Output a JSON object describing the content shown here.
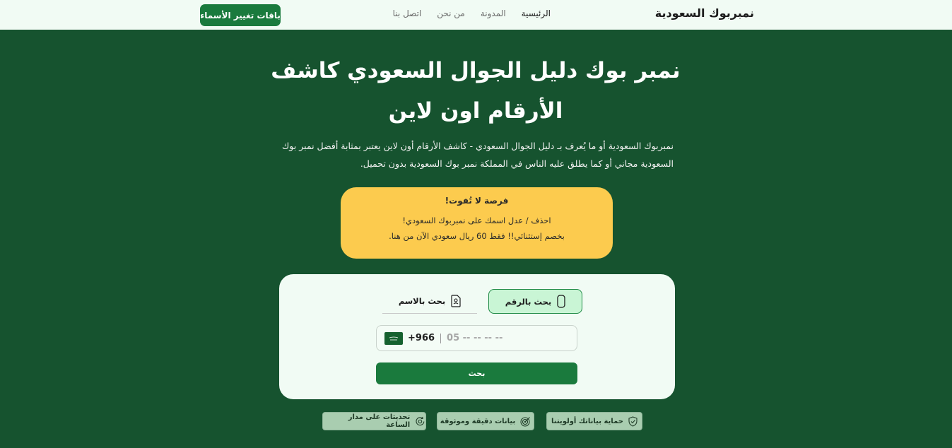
{
  "header": {
    "brand": "نمبربوك السعودية",
    "nav": [
      "الرئيسية",
      "المدونة",
      "من نحن",
      "اتصل بنا"
    ],
    "cta": "باقات تغيير الأسماء"
  },
  "hero": {
    "title_line1": "نمبر بوك دليل الجوال السعودي كاشف",
    "title_line2": "الأرقام اون لاين",
    "desc_line1": "نمبربوك السعودية أو ما يُعرف بـ دليل الجوال السعودي - كاشف الأرقام أون لاين يعتبر بمثابة أفضل نمبر بوك",
    "desc_line2": "السعودية مجاني أو كما يطلق عليه الناس في المملكة نمبر بوك السعودية بدون تحميل."
  },
  "promo": {
    "title": "فرصة لا تُفوت!",
    "line1": "احذف / عدل اسمك على نمبربوك السعودي!",
    "line2": "بخصم إستثنائي!! فقط 60 ريال سعودي الآن من هنا."
  },
  "search": {
    "tab_number": "بحث بالرقم",
    "tab_name": "بحث بالاسم",
    "country_code": "+966",
    "placeholder": "05 -- -- -- --",
    "button": "بحث"
  },
  "features": [
    {
      "label": "حماية بياناتك أولويتنا",
      "icon": "shield-icon"
    },
    {
      "label": "بيانات دقيقة وموثوقة",
      "icon": "target-icon"
    },
    {
      "label": "تحديثات على مدار الساعة",
      "icon": "refresh-gear-icon"
    }
  ],
  "colors": {
    "background": "#16532f",
    "header": "#f1fbf4",
    "accent": "#1a7a3d",
    "promo": "#fccb4e",
    "tab_active": "#c9f5d5",
    "feature": "#a9cdb0"
  }
}
